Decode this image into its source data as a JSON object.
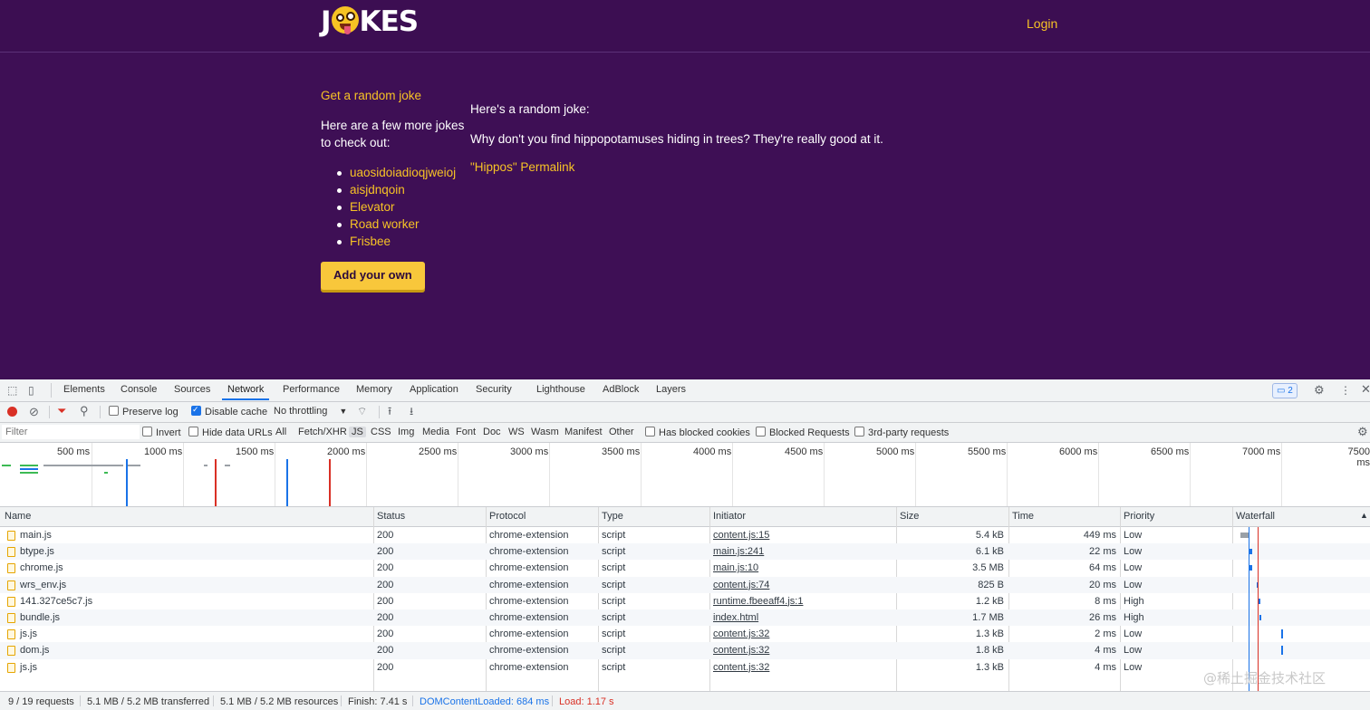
{
  "site": {
    "logo_left": "J",
    "logo_right": "KES",
    "login": "Login",
    "random_link": "Get a random joke",
    "more_text": "Here are a few more jokes to check out:",
    "jokes": [
      "uaosidoiadioqjweioj",
      "aisjdnqoin",
      "Elevator",
      "Road worker",
      "Frisbee"
    ],
    "add_button": "Add your own",
    "heading": "Here's a random joke:",
    "joke_text": "Why don't you find hippopotamuses hiding in trees? They're really good at it.",
    "permalink": "\"Hippos\" Permalink",
    "colors": {
      "background": "#3e0f55",
      "accent": "#f7c325"
    }
  },
  "devtools": {
    "tabs": [
      "Elements",
      "Console",
      "Sources",
      "Network",
      "Performance",
      "Memory",
      "Application",
      "Security",
      "Lighthouse",
      "AdBlock",
      "Layers"
    ],
    "active_tab": "Network",
    "issues_count": "2",
    "toolbar": {
      "preserve_log": "Preserve log",
      "disable_cache": "Disable cache",
      "throttling": "No throttling"
    },
    "filters": {
      "placeholder": "Filter",
      "invert": "Invert",
      "hide_data_urls": "Hide data URLs",
      "types": [
        "All",
        "Fetch/XHR",
        "JS",
        "CSS",
        "Img",
        "Media",
        "Font",
        "Doc",
        "WS",
        "Wasm",
        "Manifest",
        "Other"
      ],
      "active_type": "JS",
      "has_blocked_cookies": "Has blocked cookies",
      "blocked_requests": "Blocked Requests",
      "third_party": "3rd-party requests"
    },
    "overview_ticks": [
      "500 ms",
      "1000 ms",
      "1500 ms",
      "2000 ms",
      "2500 ms",
      "3000 ms",
      "3500 ms",
      "4000 ms",
      "4500 ms",
      "5000 ms",
      "5500 ms",
      "6000 ms",
      "6500 ms",
      "7000 ms",
      "7500 ms"
    ],
    "columns": [
      "Name",
      "Status",
      "Protocol",
      "Type",
      "Initiator",
      "Size",
      "Time",
      "Priority",
      "Waterfall"
    ],
    "rows": [
      {
        "name": "main.js",
        "status": "200",
        "protocol": "chrome-extension",
        "type": "script",
        "initiator": "content.js:15",
        "size": "5.4 kB",
        "time": "449 ms",
        "priority": "Low"
      },
      {
        "name": "btype.js",
        "status": "200",
        "protocol": "chrome-extension",
        "type": "script",
        "initiator": "main.js:241",
        "size": "6.1 kB",
        "time": "22 ms",
        "priority": "Low"
      },
      {
        "name": "chrome.js",
        "status": "200",
        "protocol": "chrome-extension",
        "type": "script",
        "initiator": "main.js:10",
        "size": "3.5 MB",
        "time": "64 ms",
        "priority": "Low"
      },
      {
        "name": "wrs_env.js",
        "status": "200",
        "protocol": "chrome-extension",
        "type": "script",
        "initiator": "content.js:74",
        "size": "825 B",
        "time": "20 ms",
        "priority": "Low"
      },
      {
        "name": "141.327ce5c7.js",
        "status": "200",
        "protocol": "chrome-extension",
        "type": "script",
        "initiator": "runtime.fbeeaff4.js:1",
        "size": "1.2 kB",
        "time": "8 ms",
        "priority": "High"
      },
      {
        "name": "bundle.js",
        "status": "200",
        "protocol": "chrome-extension",
        "type": "script",
        "initiator": "index.html",
        "size": "1.7 MB",
        "time": "26 ms",
        "priority": "High"
      },
      {
        "name": "js.js",
        "status": "200",
        "protocol": "chrome-extension",
        "type": "script",
        "initiator": "content.js:32",
        "size": "1.3 kB",
        "time": "2 ms",
        "priority": "Low"
      },
      {
        "name": "dom.js",
        "status": "200",
        "protocol": "chrome-extension",
        "type": "script",
        "initiator": "content.js:32",
        "size": "1.8 kB",
        "time": "4 ms",
        "priority": "Low"
      },
      {
        "name": "js.js",
        "status": "200",
        "protocol": "chrome-extension",
        "type": "script",
        "initiator": "content.js:32",
        "size": "1.3 kB",
        "time": "4 ms",
        "priority": "Low"
      }
    ],
    "status_bar": {
      "requests": "9 / 19 requests",
      "transferred": "5.1 MB / 5.2 MB transferred",
      "resources": "5.1 MB / 5.2 MB resources",
      "finish": "Finish: 7.41 s",
      "dom_content_loaded": "DOMContentLoaded: 684 ms",
      "load": "Load: 1.17 s"
    }
  },
  "watermark": "@稀土掘金技术社区"
}
